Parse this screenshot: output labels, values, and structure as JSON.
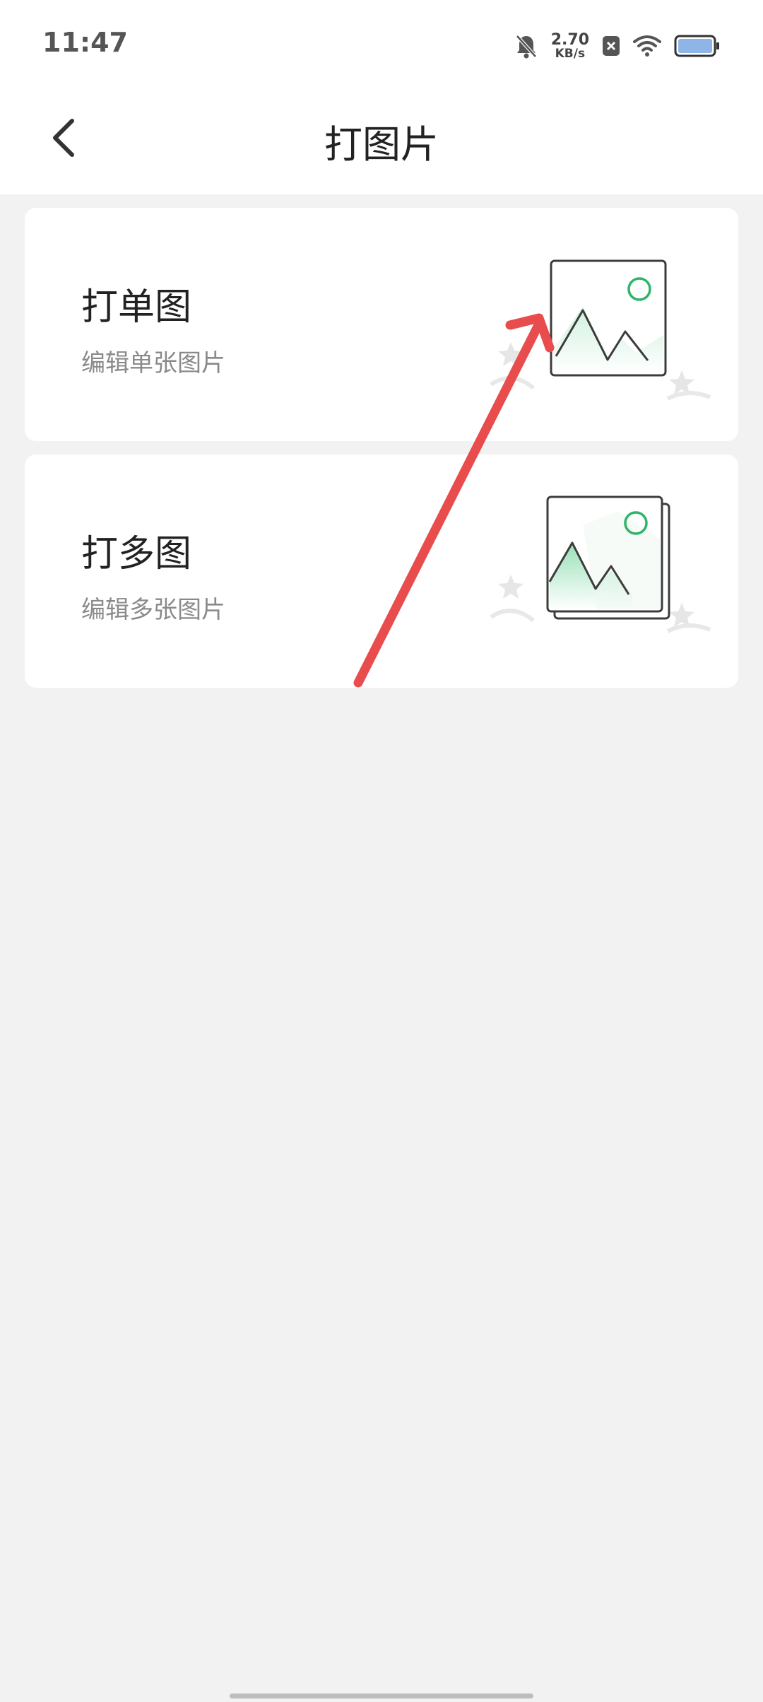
{
  "status_bar": {
    "time": "11:47",
    "net_speed_value": "2.70",
    "net_speed_unit": "KB/s",
    "icons": [
      "bell-muted-icon",
      "x-badge-icon",
      "wifi-icon",
      "battery-icon"
    ]
  },
  "header": {
    "title": "打图片",
    "back_icon": "chevron-left-icon"
  },
  "options": [
    {
      "title": "打单图",
      "subtitle": "编辑单张图片",
      "icon": "single-image-icon"
    },
    {
      "title": "打多图",
      "subtitle": "编辑多张图片",
      "icon": "multi-image-icon"
    }
  ],
  "colors": {
    "accent_green": "#2fb46a",
    "annotation_red": "#e84c4c",
    "background": "#f2f2f2"
  }
}
